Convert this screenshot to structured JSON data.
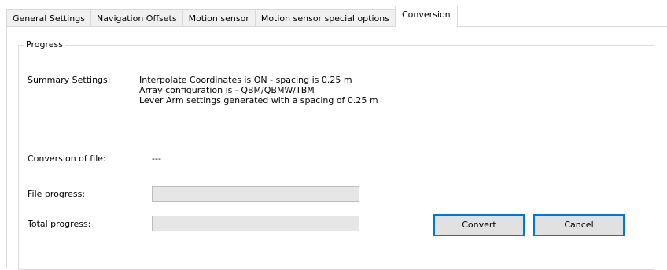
{
  "tabs": [
    {
      "label": "General Settings",
      "active": false
    },
    {
      "label": "Navigation Offsets",
      "active": false
    },
    {
      "label": "Motion sensor",
      "active": false
    },
    {
      "label": "Motion sensor special options",
      "active": false
    },
    {
      "label": "Conversion",
      "active": true
    }
  ],
  "progress_group": {
    "title": "Progress",
    "summary_label": "Summary Settings:",
    "summary_lines": [
      "Interpolate Coordinates is ON - spacing is 0.25 m",
      "Array configuration is - QBM/QBMW/TBM",
      "Lever Arm settings generated with a spacing of 0.25 m"
    ],
    "conversion_label": "Conversion of file:",
    "conversion_value": "---",
    "file_progress_label": "File progress:",
    "file_progress_value": 0,
    "total_progress_label": "Total progress:",
    "total_progress_value": 0
  },
  "buttons": {
    "convert": "Convert",
    "cancel": "Cancel"
  },
  "colors": {
    "button_border": "#0078d7",
    "progress_fill": "#06b025"
  }
}
